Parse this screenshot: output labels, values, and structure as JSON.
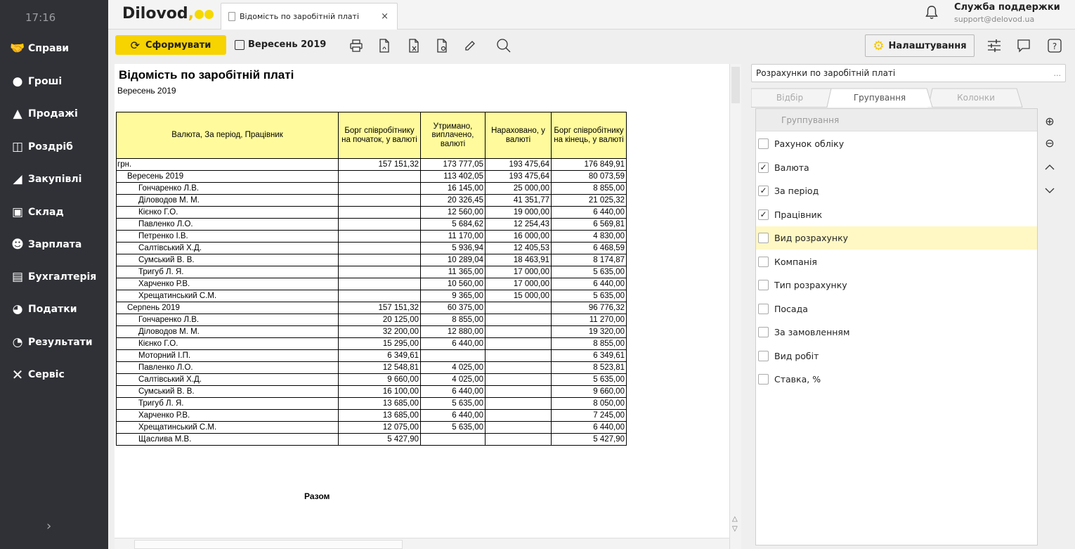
{
  "sidebar": {
    "time": "17:16",
    "items": [
      {
        "label": "Справи",
        "icon": "handshake-icon"
      },
      {
        "label": "Гроші",
        "icon": "coins-icon"
      },
      {
        "label": "Продажі",
        "icon": "sales-chart-icon"
      },
      {
        "label": "Роздріб",
        "icon": "shopping-bag-icon"
      },
      {
        "label": "Закупівлі",
        "icon": "cart-icon"
      },
      {
        "label": "Склад",
        "icon": "warehouse-icon"
      },
      {
        "label": "Зарплата",
        "icon": "people-icon"
      },
      {
        "label": "Бухгалтерія",
        "icon": "books-icon"
      },
      {
        "label": "Податки",
        "icon": "tax-icon"
      },
      {
        "label": "Результати",
        "icon": "pie-chart-icon"
      },
      {
        "label": "Сервіс",
        "icon": "tools-icon"
      }
    ],
    "expand_symbol": "›"
  },
  "header": {
    "logo": "Dilovod",
    "logo_comma": ",",
    "tab_title": "Відомість по заробітній платі",
    "tab_close": "×",
    "support_name": "Служба поддержки",
    "support_email": "support@delovod.ua"
  },
  "toolbar": {
    "generate_label": "Сформувати",
    "period_label": "Вересень 2019",
    "settings_label": "Налаштування"
  },
  "report": {
    "title": "Відомість по заробітній платі",
    "subtitle": "Вересень 2019",
    "columns": [
      "Валюта, За період, Працівник",
      "Борг співробітнику на початок, у валюті",
      "Утримано, виплачено, валюті",
      "Нараховано, у валюті",
      "Борг співробітнику на кінець, у валюті"
    ],
    "rows": [
      {
        "level": 0,
        "name": "грн.",
        "v1": "157 151,32",
        "v2": "173 777,05",
        "v3": "193 475,64",
        "v4": "176 849,91"
      },
      {
        "level": 1,
        "name": "Вересень 2019",
        "v1": "",
        "v2": "113 402,05",
        "v3": "193 475,64",
        "v4": "80 073,59"
      },
      {
        "level": 2,
        "name": "Гончаренко Л.В.",
        "v1": "",
        "v2": "16 145,00",
        "v3": "25 000,00",
        "v4": "8 855,00"
      },
      {
        "level": 2,
        "name": "Діловодов М. М.",
        "v1": "",
        "v2": "20 326,45",
        "v3": "41 351,77",
        "v4": "21 025,32"
      },
      {
        "level": 2,
        "name": "Кієнко Г.О.",
        "v1": "",
        "v2": "12 560,00",
        "v3": "19 000,00",
        "v4": "6 440,00"
      },
      {
        "level": 2,
        "name": "Павленко Л.О.",
        "v1": "",
        "v2": "5 684,62",
        "v3": "12 254,43",
        "v4": "6 569,81"
      },
      {
        "level": 2,
        "name": "Петренко І.В.",
        "v1": "",
        "v2": "11 170,00",
        "v3": "16 000,00",
        "v4": "4 830,00"
      },
      {
        "level": 2,
        "name": "Салтівський Х.Д.",
        "v1": "",
        "v2": "5 936,94",
        "v3": "12 405,53",
        "v4": "6 468,59"
      },
      {
        "level": 2,
        "name": "Сумський В. В.",
        "v1": "",
        "v2": "10 289,04",
        "v3": "18 463,91",
        "v4": "8 174,87"
      },
      {
        "level": 2,
        "name": "Тригуб Л. Я.",
        "v1": "",
        "v2": "11 365,00",
        "v3": "17 000,00",
        "v4": "5 635,00"
      },
      {
        "level": 2,
        "name": "Харченко Р.В.",
        "v1": "",
        "v2": "10 560,00",
        "v3": "17 000,00",
        "v4": "6 440,00"
      },
      {
        "level": 2,
        "name": "Хрещатинський С.М.",
        "v1": "",
        "v2": "9 365,00",
        "v3": "15 000,00",
        "v4": "5 635,00"
      },
      {
        "level": 1,
        "name": "Серпень 2019",
        "v1": "157 151,32",
        "v2": "60 375,00",
        "v3": "",
        "v4": "96 776,32"
      },
      {
        "level": 2,
        "name": "Гончаренко Л.В.",
        "v1": "20 125,00",
        "v2": "8 855,00",
        "v3": "",
        "v4": "11 270,00"
      },
      {
        "level": 2,
        "name": "Діловодов М. М.",
        "v1": "32 200,00",
        "v2": "12 880,00",
        "v3": "",
        "v4": "19 320,00"
      },
      {
        "level": 2,
        "name": "Кієнко Г.О.",
        "v1": "15 295,00",
        "v2": "6 440,00",
        "v3": "",
        "v4": "8 855,00"
      },
      {
        "level": 2,
        "name": "Моторний І.П.",
        "v1": "6 349,61",
        "v2": "",
        "v3": "",
        "v4": "6 349,61"
      },
      {
        "level": 2,
        "name": "Павленко Л.О.",
        "v1": "12 548,81",
        "v2": "4 025,00",
        "v3": "",
        "v4": "8 523,81"
      },
      {
        "level": 2,
        "name": "Салтівський Х.Д.",
        "v1": "9 660,00",
        "v2": "4 025,00",
        "v3": "",
        "v4": "5 635,00"
      },
      {
        "level": 2,
        "name": "Сумський В. В.",
        "v1": "16 100,00",
        "v2": "6 440,00",
        "v3": "",
        "v4": "9 660,00"
      },
      {
        "level": 2,
        "name": "Тригуб Л. Я.",
        "v1": "13 685,00",
        "v2": "5 635,00",
        "v3": "",
        "v4": "8 050,00"
      },
      {
        "level": 2,
        "name": "Харченко Р.В.",
        "v1": "13 685,00",
        "v2": "6 440,00",
        "v3": "",
        "v4": "7 245,00"
      },
      {
        "level": 2,
        "name": "Хрещатинський С.М.",
        "v1": "12 075,00",
        "v2": "5 635,00",
        "v3": "",
        "v4": "6 440,00"
      },
      {
        "level": 2,
        "name": "Щаслива М.В.",
        "v1": "5 427,90",
        "v2": "",
        "v3": "",
        "v4": "5 427,90"
      }
    ],
    "totals_label": "Разом"
  },
  "settings_panel": {
    "report_select": "Розрахунки по заробітній платі",
    "report_select_more": "...",
    "tabs": [
      "Відбір",
      "Групування",
      "Колонки"
    ],
    "active_tab": "Групування",
    "list_header": "Группування",
    "items": [
      {
        "label": "Рахунок обліку",
        "checked": false
      },
      {
        "label": "Валюта",
        "checked": true
      },
      {
        "label": "За період",
        "checked": true
      },
      {
        "label": "Працівник",
        "checked": true
      },
      {
        "label": "Вид розрахунку",
        "checked": false,
        "selected": true
      },
      {
        "label": "Компанія",
        "checked": false
      },
      {
        "label": "Тип розрахунку",
        "checked": false
      },
      {
        "label": "Посада",
        "checked": false
      },
      {
        "label": "За замовленням",
        "checked": false
      },
      {
        "label": "Вид робіт",
        "checked": false
      },
      {
        "label": "Ставка, %",
        "checked": false
      }
    ],
    "highlight_color": "#fff8c4"
  },
  "colors": {
    "sidebar_bg": "#2f3136",
    "accent": "#f7d300",
    "table_header_bg": "#fffb9c"
  }
}
